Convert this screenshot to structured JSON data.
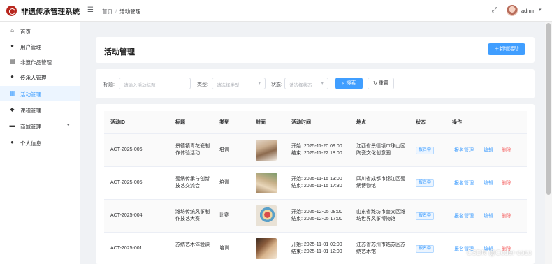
{
  "header": {
    "app_title": "非遗传承管理系统",
    "breadcrumb": [
      "首页",
      "活动管理"
    ],
    "username": "admin"
  },
  "sidebar": {
    "items": [
      {
        "label": "首页",
        "icon": "home-icon",
        "active": false
      },
      {
        "label": "用户管理",
        "icon": "user-icon",
        "active": false
      },
      {
        "label": "非遗作品管理",
        "icon": "document-icon",
        "active": false
      },
      {
        "label": "传承人管理",
        "icon": "user-icon",
        "active": false
      },
      {
        "label": "活动管理",
        "icon": "calendar-icon",
        "active": true
      },
      {
        "label": "课程管理",
        "icon": "graduation-cap-icon",
        "active": false
      },
      {
        "label": "商城管理",
        "icon": "shop-icon",
        "active": false,
        "expandable": true
      },
      {
        "label": "个人信息",
        "icon": "user-icon",
        "active": false
      }
    ]
  },
  "page": {
    "title": "活动管理",
    "add_button": "新增活动"
  },
  "filters": {
    "title_label": "标题:",
    "title_placeholder": "请输入活动标题",
    "type_label": "类型:",
    "type_placeholder": "请选择类型",
    "status_label": "状态:",
    "status_placeholder": "请选择状态",
    "search_button": "搜索",
    "reset_button": "重置"
  },
  "table": {
    "columns": [
      "活动ID",
      "标题",
      "类型",
      "封面",
      "活动时间",
      "地点",
      "状态",
      "操作"
    ],
    "rows": [
      {
        "id": "ACT-2025-006",
        "title": "景德镇青花瓷制作体验活动",
        "type": "培训",
        "start": "开始: 2025-11-20 09:00",
        "end": "结束: 2025-11-22 18:00",
        "location": "江西省景德镇市珠山区陶瓷文化创意园",
        "status": "报名中"
      },
      {
        "id": "ACT-2025-005",
        "title": "蜀绣传承与创新技艺交流会",
        "type": "培训",
        "start": "开始: 2025-11-15 13:00",
        "end": "结束: 2025-11-15 17:30",
        "location": "四川省成都市锦江区蜀绣博物馆",
        "status": "报名中"
      },
      {
        "id": "ACT-2025-004",
        "title": "潍坊传统风筝制作技艺大赛",
        "type": "比赛",
        "start": "开始: 2025-12-05 08:00",
        "end": "结束: 2025-12-05 17:00",
        "location": "山东省潍坊市奎文区潍坊世界风筝博物馆",
        "status": "报名中"
      },
      {
        "id": "ACT-2025-001",
        "title": "苏绣艺术体验课",
        "type": "培训",
        "start": "开始: 2025-11-01 09:00",
        "end": "结束: 2025-11-01 12:00",
        "location": "江苏省苏州市姑苏区苏绣艺术馆",
        "status": "报名中"
      }
    ],
    "actions": {
      "manage": "报名管理",
      "edit": "编辑",
      "delete": "删除"
    }
  },
  "watermark": "CSDN @Coder-coco"
}
